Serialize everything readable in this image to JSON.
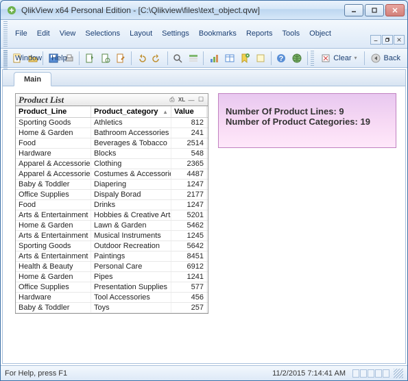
{
  "window": {
    "title": "QlikView x64 Personal Edition - [C:\\Qlikview\\files\\text_object.qvw]"
  },
  "menu": {
    "items": [
      "File",
      "Edit",
      "View",
      "Selections",
      "Layout",
      "Settings",
      "Bookmarks",
      "Reports",
      "Tools",
      "Object",
      "Window",
      "Help"
    ]
  },
  "toolbar": {
    "clear_label": "Clear",
    "back_label": "Back"
  },
  "tabs": {
    "main": "Main"
  },
  "product_list": {
    "title": "Product List",
    "columns": {
      "line": "Product_Line",
      "category": "Product_category",
      "value": "Value"
    },
    "rows": [
      {
        "line": "Sporting Goods",
        "category": "Athletics",
        "value": "812"
      },
      {
        "line": "Home & Garden",
        "category": "Bathroom Accessories",
        "value": "241"
      },
      {
        "line": "Food",
        "category": "Beverages & Tobacco",
        "value": "2514"
      },
      {
        "line": "Hardware",
        "category": "Blocks",
        "value": "548"
      },
      {
        "line": "Apparel & Accessories",
        "category": "Clothing",
        "value": "2365"
      },
      {
        "line": "Apparel & Accessories",
        "category": "Costumes & Accessories",
        "value": "4487"
      },
      {
        "line": "Baby & Toddler",
        "category": "Diapering",
        "value": "1247"
      },
      {
        "line": "Office Supplies",
        "category": "Dispaly Borad",
        "value": "2177"
      },
      {
        "line": "Food",
        "category": "Drinks",
        "value": "1247"
      },
      {
        "line": "Arts & Entertainment",
        "category": "Hobbies & Creative Arts",
        "value": "5201"
      },
      {
        "line": "Home & Garden",
        "category": "Lawn & Garden",
        "value": "5462"
      },
      {
        "line": "Arts & Entertainment",
        "category": "Musical Instruments",
        "value": "1245"
      },
      {
        "line": "Sporting Goods",
        "category": "Outdoor Recreation",
        "value": "5642"
      },
      {
        "line": "Arts & Entertainment",
        "category": "Paintings",
        "value": "8451"
      },
      {
        "line": "Health & Beauty",
        "category": "Personal Care",
        "value": "6912"
      },
      {
        "line": "Home & Garden",
        "category": "Pipes",
        "value": "1241"
      },
      {
        "line": "Office Supplies",
        "category": "Presentation Supplies",
        "value": "577"
      },
      {
        "line": "Hardware",
        "category": "Tool Accessories",
        "value": "456"
      },
      {
        "line": "Baby & Toddler",
        "category": "Toys",
        "value": "257"
      }
    ]
  },
  "text_object": {
    "line1": "Number Of Product Lines: 9",
    "line2": "Number of Product Categories: 19"
  },
  "status": {
    "help": "For Help, press F1",
    "datetime": "11/2/2015 7:14:41 AM"
  }
}
